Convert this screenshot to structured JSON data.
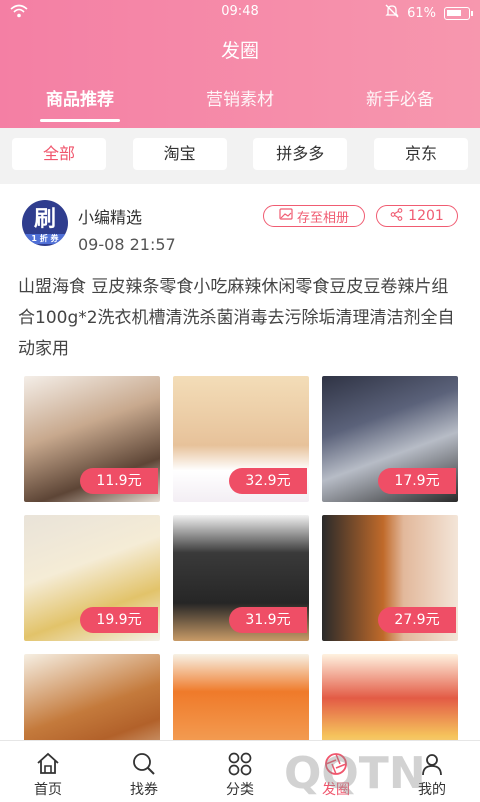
{
  "status_bar": {
    "time": "09:48",
    "battery": "61%",
    "icons": [
      "wifi-icon",
      "bell-off-icon",
      "battery-icon"
    ]
  },
  "header": {
    "title": "发圈"
  },
  "tabs": [
    {
      "label": "商品推荐",
      "active": true
    },
    {
      "label": "营销素材",
      "active": false
    },
    {
      "label": "新手必备",
      "active": false
    }
  ],
  "filters": [
    {
      "label": "全部",
      "active": true
    },
    {
      "label": "淘宝",
      "active": false
    },
    {
      "label": "拼多多",
      "active": false
    },
    {
      "label": "京东",
      "active": false
    }
  ],
  "post": {
    "author": "小编精选",
    "time": "09-08 21:57",
    "avatar_text": "刷",
    "avatar_sub": "1 折 券",
    "save_label": "存至相册",
    "share_count": "1201",
    "content": "山盟海食 豆皮辣条零食小吃麻辣休闲零食豆皮豆卷辣片组合100g*2洗衣机槽清洗杀菌消毒去污除垢清理清洁剂全自动家用",
    "products": [
      {
        "price": "11.9元"
      },
      {
        "price": "32.9元"
      },
      {
        "price": "17.9元"
      },
      {
        "price": "19.9元"
      },
      {
        "price": "31.9元"
      },
      {
        "price": "27.9元"
      },
      {
        "price": ""
      },
      {
        "price": ""
      },
      {
        "price": ""
      }
    ]
  },
  "bottom_nav": [
    {
      "label": "首页",
      "icon": "home-icon",
      "active": false
    },
    {
      "label": "找券",
      "icon": "search-icon",
      "active": false
    },
    {
      "label": "分类",
      "icon": "category-icon",
      "active": false
    },
    {
      "label": "发圈",
      "icon": "aperture-icon",
      "active": true
    },
    {
      "label": "我的",
      "icon": "user-icon",
      "active": false
    }
  ],
  "colors": {
    "accent": "#f0566d",
    "header_start": "#f47fa4",
    "header_end": "#f797ae"
  }
}
